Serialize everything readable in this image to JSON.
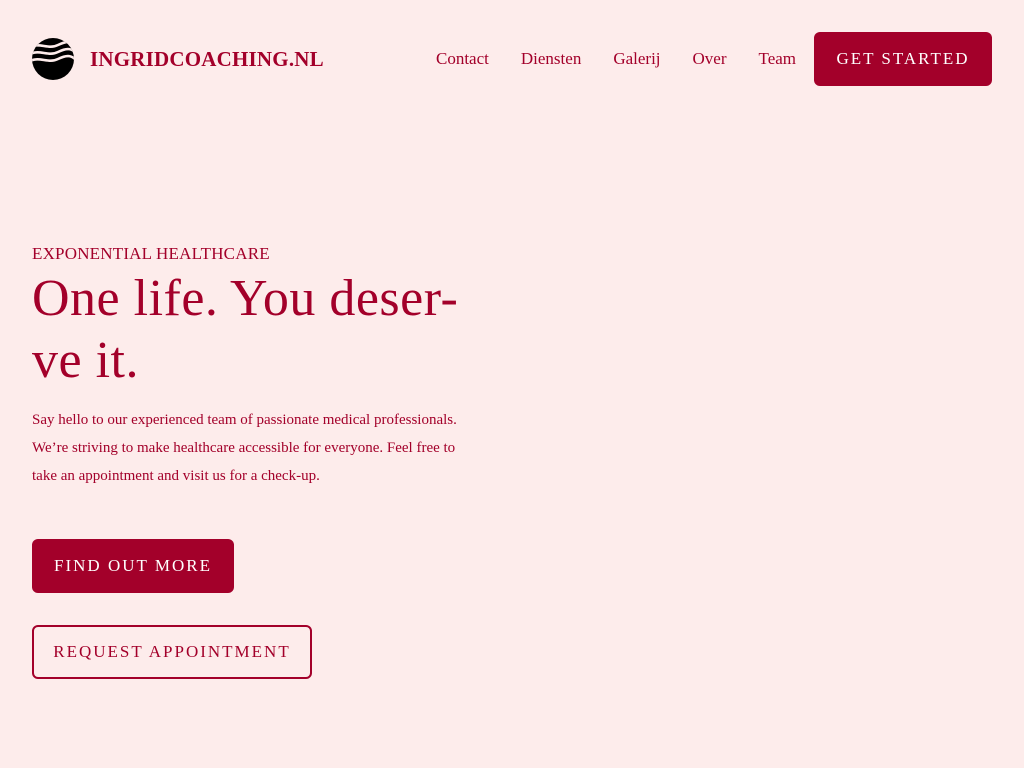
{
  "brand": {
    "name": "INGRIDCOACHING.NL",
    "logo_icon": "waves-globe-icon"
  },
  "nav": {
    "items": [
      {
        "label": "Contact"
      },
      {
        "label": "Diensten"
      },
      {
        "label": "Galerij"
      },
      {
        "label": "Over"
      },
      {
        "label": "Team"
      }
    ],
    "cta_label": "GET STARTED"
  },
  "hero": {
    "eyebrow": "EXPONENTIAL HEALTHCARE",
    "title": "One life. You deser-ve it.",
    "description": "Say hello to our experienced team of passionate medical professionals. We’re striving to make healthcare accessible for everyone. Feel free to take an appointment and visit us for a check-up.",
    "primary_button": "FIND OUT MORE",
    "secondary_button": "REQUEST APPOINTMENT"
  },
  "colors": {
    "background": "#fdeceb",
    "accent": "#a3002a",
    "button_text": "#ffffff"
  }
}
